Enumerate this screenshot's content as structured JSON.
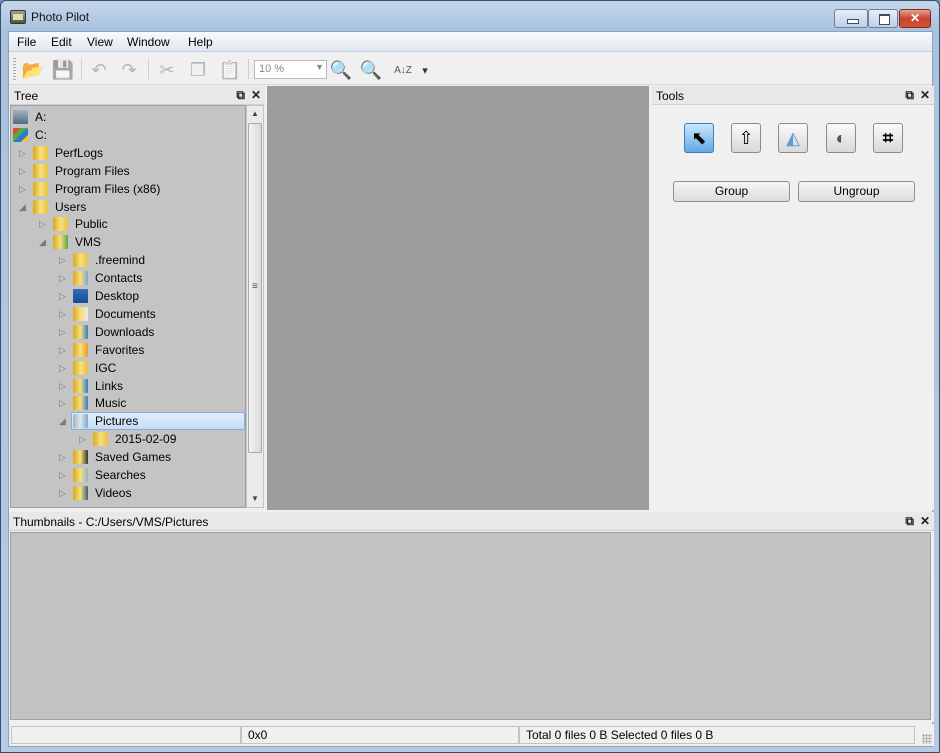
{
  "window": {
    "title": "Photo Pilot",
    "app_icon": "photo-pilot-icon"
  },
  "menu": [
    "File",
    "Edit",
    "View",
    "Window",
    "Help"
  ],
  "toolbar": {
    "buttons": [
      {
        "name": "open-button",
        "icon": "folder-open-icon",
        "glyph": "📂"
      },
      {
        "name": "save-button",
        "icon": "save-icon",
        "glyph": "💾"
      },
      {
        "name": "undo-button",
        "icon": "undo-icon",
        "glyph": "↶"
      },
      {
        "name": "redo-button",
        "icon": "redo-icon",
        "glyph": "↷"
      },
      {
        "name": "cut-button",
        "icon": "scissors-icon",
        "glyph": "✂"
      },
      {
        "name": "copy-button",
        "icon": "copy-icon",
        "glyph": "❐"
      },
      {
        "name": "paste-button",
        "icon": "paste-icon",
        "glyph": "📋"
      }
    ],
    "zoom_value": "10 %",
    "zoom_in_icon": "zoom-in-icon",
    "zoom_out_icon": "zoom-out-icon",
    "sort_label": "A↓Z",
    "more_label": "▾"
  },
  "tree": {
    "title": "Tree",
    "float_glyph": "🗗",
    "close_glyph": "✕",
    "nodes": [
      {
        "label": "A:",
        "level": 0,
        "expander": "",
        "icon": "floppy-drive-icon"
      },
      {
        "label": "C:",
        "level": 0,
        "expander": "",
        "icon": "hard-drive-icon"
      },
      {
        "label": "PerfLogs",
        "level": 1,
        "expander": "▷",
        "icon": "folder-icon"
      },
      {
        "label": "Program Files",
        "level": 1,
        "expander": "▷",
        "icon": "folder-icon"
      },
      {
        "label": "Program Files (x86)",
        "level": 1,
        "expander": "▷",
        "icon": "folder-icon"
      },
      {
        "label": "Users",
        "level": 1,
        "expander": "◢",
        "icon": "folder-icon"
      },
      {
        "label": "Public",
        "level": 2,
        "expander": "▷",
        "icon": "folder-icon"
      },
      {
        "label": "VMS",
        "level": 2,
        "expander": "◢",
        "icon": "user-folder-icon"
      },
      {
        "label": ".freemind",
        "level": 3,
        "expander": "▷",
        "icon": "folder-icon"
      },
      {
        "label": "Contacts",
        "level": 3,
        "expander": "▷",
        "icon": "contacts-folder-icon"
      },
      {
        "label": "Desktop",
        "level": 3,
        "expander": "▷",
        "icon": "desktop-icon"
      },
      {
        "label": "Documents",
        "level": 3,
        "expander": "▷",
        "icon": "documents-folder-icon"
      },
      {
        "label": "Downloads",
        "level": 3,
        "expander": "▷",
        "icon": "downloads-folder-icon"
      },
      {
        "label": "Favorites",
        "level": 3,
        "expander": "▷",
        "icon": "favorites-folder-icon"
      },
      {
        "label": "IGC",
        "level": 3,
        "expander": "▷",
        "icon": "folder-icon"
      },
      {
        "label": "Links",
        "level": 3,
        "expander": "▷",
        "icon": "links-folder-icon"
      },
      {
        "label": "Music",
        "level": 3,
        "expander": "▷",
        "icon": "music-folder-icon"
      },
      {
        "label": "Pictures",
        "level": 3,
        "expander": "◢",
        "icon": "pictures-folder-icon",
        "selected": true
      },
      {
        "label": "2015-02-09",
        "level": 4,
        "expander": "▷",
        "icon": "folder-icon"
      },
      {
        "label": "Saved Games",
        "level": 3,
        "expander": "▷",
        "icon": "saved-games-folder-icon"
      },
      {
        "label": "Searches",
        "level": 3,
        "expander": "▷",
        "icon": "searches-folder-icon"
      },
      {
        "label": "Videos",
        "level": 3,
        "expander": "▷",
        "icon": "videos-folder-icon"
      }
    ]
  },
  "tools": {
    "title": "Tools",
    "float_glyph": "🗗",
    "close_glyph": "✕",
    "icons": [
      {
        "name": "select-tool",
        "icon": "pointer-icon",
        "glyph": "⬉",
        "active": true
      },
      {
        "name": "move-tool",
        "icon": "move-layer-icon",
        "glyph": "⇧"
      },
      {
        "name": "flip-tool",
        "icon": "flip-icon",
        "glyph": "◭"
      },
      {
        "name": "adjust-tool",
        "icon": "contrast-icon",
        "glyph": "◐"
      },
      {
        "name": "crop-tool",
        "icon": "crop-icon",
        "glyph": "⌗"
      }
    ],
    "group_label": "Group",
    "ungroup_label": "Ungroup"
  },
  "thumbnails": {
    "title": "Thumbnails - C:/Users/VMS/Pictures",
    "float_glyph": "🗗",
    "close_glyph": "✕"
  },
  "status": {
    "cell1": "",
    "dimensions": "0x0",
    "summary": "Total 0 files 0 B  Selected 0 files 0 B"
  }
}
